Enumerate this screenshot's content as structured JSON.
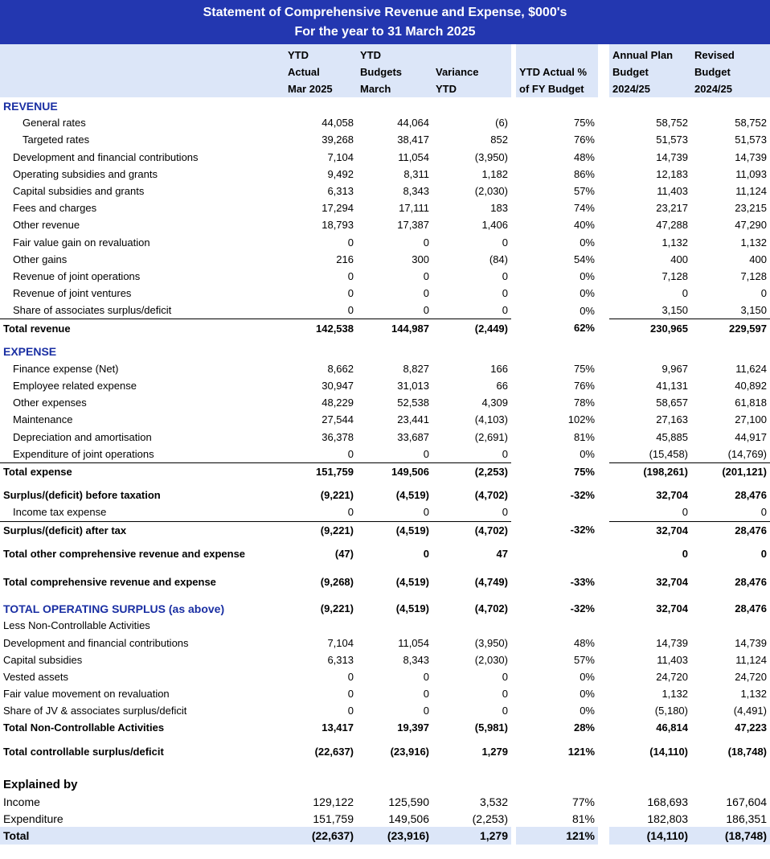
{
  "title": {
    "line1": "Statement of Comprehensive Revenue and Expense, $000's",
    "line2": "For the year to 31 March 2025"
  },
  "headers": {
    "ytd_actual": [
      "YTD",
      "Actual",
      "Mar 2025"
    ],
    "ytd_budget": [
      "YTD",
      "Budgets",
      "March"
    ],
    "variance": [
      "Variance",
      "YTD"
    ],
    "pct": [
      "YTD Actual %",
      "of FY Budget"
    ],
    "annual_plan": [
      "Annual Plan",
      "Budget",
      "2024/25"
    ],
    "revised": [
      "Revised",
      "Budget",
      "2024/25"
    ]
  },
  "revenue": {
    "heading": "REVENUE",
    "rows": [
      {
        "label": "General rates",
        "indent": 2,
        "actual": "44,058",
        "budget": "44,064",
        "variance": "(6)",
        "pct": "75%",
        "plan": "58,752",
        "revised": "58,752"
      },
      {
        "label": "Targeted rates",
        "indent": 2,
        "actual": "39,268",
        "budget": "38,417",
        "variance": "852",
        "pct": "76%",
        "plan": "51,573",
        "revised": "51,573"
      },
      {
        "label": "Development and financial contributions",
        "indent": 1,
        "actual": "7,104",
        "budget": "11,054",
        "variance": "(3,950)",
        "pct": "48%",
        "plan": "14,739",
        "revised": "14,739"
      },
      {
        "label": "Operating subsidies and grants",
        "indent": 1,
        "actual": "9,492",
        "budget": "8,311",
        "variance": "1,182",
        "pct": "86%",
        "plan": "12,183",
        "revised": "11,093"
      },
      {
        "label": "Capital subsidies and grants",
        "indent": 1,
        "actual": "6,313",
        "budget": "8,343",
        "variance": "(2,030)",
        "pct": "57%",
        "plan": "11,403",
        "revised": "11,124"
      },
      {
        "label": "Fees and charges",
        "indent": 1,
        "actual": "17,294",
        "budget": "17,111",
        "variance": "183",
        "pct": "74%",
        "plan": "23,217",
        "revised": "23,215"
      },
      {
        "label": "Other revenue",
        "indent": 1,
        "actual": "18,793",
        "budget": "17,387",
        "variance": "1,406",
        "pct": "40%",
        "plan": "47,288",
        "revised": "47,290"
      },
      {
        "label": "Fair value gain on revaluation",
        "indent": 1,
        "actual": "0",
        "budget": "0",
        "variance": "0",
        "pct": "0%",
        "plan": "1,132",
        "revised": "1,132"
      },
      {
        "label": "Other gains",
        "indent": 1,
        "actual": "216",
        "budget": "300",
        "variance": "(84)",
        "pct": "54%",
        "plan": "400",
        "revised": "400"
      },
      {
        "label": "Revenue of joint operations",
        "indent": 1,
        "actual": "0",
        "budget": "0",
        "variance": "0",
        "pct": "0%",
        "plan": "7,128",
        "revised": "7,128"
      },
      {
        "label": "Revenue of joint ventures",
        "indent": 1,
        "actual": "0",
        "budget": "0",
        "variance": "0",
        "pct": "0%",
        "plan": "0",
        "revised": "0"
      },
      {
        "label": "Share of associates surplus/deficit",
        "indent": 1,
        "actual": "0",
        "budget": "0",
        "variance": "0",
        "pct": "0%",
        "plan": "3,150",
        "revised": "3,150"
      }
    ],
    "total": {
      "label": "Total revenue",
      "actual": "142,538",
      "budget": "144,987",
      "variance": "(2,449)",
      "pct": "62%",
      "plan": "230,965",
      "revised": "229,597"
    }
  },
  "expense": {
    "heading": "EXPENSE",
    "rows": [
      {
        "label": "Finance expense (Net)",
        "indent": 1,
        "actual": "8,662",
        "budget": "8,827",
        "variance": "166",
        "pct": "75%",
        "plan": "9,967",
        "revised": "11,624"
      },
      {
        "label": "Employee related expense",
        "indent": 1,
        "actual": "30,947",
        "budget": "31,013",
        "variance": "66",
        "pct": "76%",
        "plan": "41,131",
        "revised": "40,892"
      },
      {
        "label": "Other expenses",
        "indent": 1,
        "actual": "48,229",
        "budget": "52,538",
        "variance": "4,309",
        "pct": "78%",
        "plan": "58,657",
        "revised": "61,818"
      },
      {
        "label": "Maintenance",
        "indent": 1,
        "actual": "27,544",
        "budget": "23,441",
        "variance": "(4,103)",
        "pct": "102%",
        "plan": "27,163",
        "revised": "27,100"
      },
      {
        "label": "Depreciation and amortisation",
        "indent": 1,
        "actual": "36,378",
        "budget": "33,687",
        "variance": "(2,691)",
        "pct": "81%",
        "plan": "45,885",
        "revised": "44,917"
      },
      {
        "label": "Expenditure of joint operations",
        "indent": 1,
        "actual": "0",
        "budget": "0",
        "variance": "0",
        "pct": "0%",
        "plan": "(15,458)",
        "revised": "(14,769)"
      }
    ],
    "total": {
      "label": "Total expense",
      "actual": "151,759",
      "budget": "149,506",
      "variance": "(2,253)",
      "pct": "75%",
      "plan": "(198,261)",
      "revised": "(201,121)"
    }
  },
  "surplus_before_tax": {
    "label": "Surplus/(deficit) before taxation",
    "actual": "(9,221)",
    "budget": "(4,519)",
    "variance": "(4,702)",
    "pct": "-32%",
    "plan": "32,704",
    "revised": "28,476"
  },
  "income_tax": {
    "label": "Income tax expense",
    "actual": "0",
    "budget": "0",
    "variance": "0",
    "pct": "",
    "plan": "0",
    "revised": "0"
  },
  "surplus_after_tax": {
    "label": "Surplus/(deficit) after tax",
    "actual": "(9,221)",
    "budget": "(4,519)",
    "variance": "(4,702)",
    "pct": "-32%",
    "plan": "32,704",
    "revised": "28,476"
  },
  "other_comprehensive": {
    "label": "Total other comprehensive revenue and expense",
    "actual": "(47)",
    "budget": "0",
    "variance": "47",
    "pct": "",
    "plan": "0",
    "revised": "0"
  },
  "total_comprehensive": {
    "label": "Total comprehensive revenue and expense",
    "actual": "(9,268)",
    "budget": "(4,519)",
    "variance": "(4,749)",
    "pct": "-33%",
    "plan": "32,704",
    "revised": "28,476"
  },
  "operating_surplus": {
    "label": "TOTAL OPERATING SURPLUS (as above)",
    "actual": "(9,221)",
    "budget": "(4,519)",
    "variance": "(4,702)",
    "pct": "-32%",
    "plan": "32,704",
    "revised": "28,476"
  },
  "non_controllable": {
    "heading": "Less Non-Controllable Activities",
    "rows": [
      {
        "label": "Development and financial contributions",
        "actual": "7,104",
        "budget": "11,054",
        "variance": "(3,950)",
        "pct": "48%",
        "plan": "14,739",
        "revised": "14,739"
      },
      {
        "label": "Capital subsidies",
        "actual": "6,313",
        "budget": "8,343",
        "variance": "(2,030)",
        "pct": "57%",
        "plan": "11,403",
        "revised": "11,124"
      },
      {
        "label": "Vested assets",
        "actual": "0",
        "budget": "0",
        "variance": "0",
        "pct": "0%",
        "plan": "24,720",
        "revised": "24,720"
      },
      {
        "label": "Fair value movement on revaluation",
        "actual": "0",
        "budget": "0",
        "variance": "0",
        "pct": "0%",
        "plan": "1,132",
        "revised": "1,132"
      },
      {
        "label": "Share of JV & associates surplus/deficit",
        "actual": "0",
        "budget": "0",
        "variance": "0",
        "pct": "0%",
        "plan": "(5,180)",
        "revised": "(4,491)"
      }
    ],
    "total": {
      "label": "Total Non-Controllable Activities",
      "actual": "13,417",
      "budget": "19,397",
      "variance": "(5,981)",
      "pct": "28%",
      "plan": "46,814",
      "revised": "47,223"
    }
  },
  "controllable": {
    "label": "Total controllable surplus/deficit",
    "actual": "(22,637)",
    "budget": "(23,916)",
    "variance": "1,279",
    "pct": "121%",
    "plan": "(14,110)",
    "revised": "(18,748)"
  },
  "explained": {
    "heading": "Explained by",
    "rows": [
      {
        "label": "Income",
        "actual": "129,122",
        "budget": "125,590",
        "variance": "3,532",
        "pct": "77%",
        "plan": "168,693",
        "revised": "167,604"
      },
      {
        "label": "Expenditure",
        "actual": "151,759",
        "budget": "149,506",
        "variance": "(2,253)",
        "pct": "81%",
        "plan": "182,803",
        "revised": "186,351"
      }
    ],
    "total": {
      "label": "Total",
      "actual": "(22,637)",
      "budget": "(23,916)",
      "variance": "1,279",
      "pct": "121%",
      "plan": "(14,110)",
      "revised": "(18,748)"
    }
  }
}
